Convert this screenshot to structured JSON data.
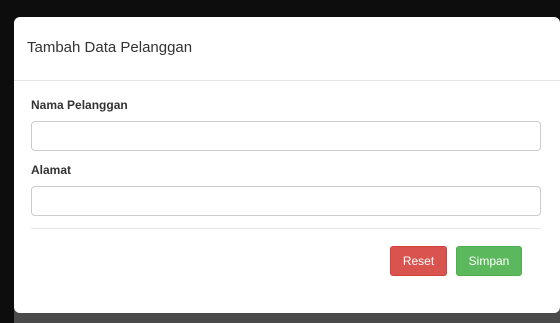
{
  "modal": {
    "title": "Tambah Data Pelanggan"
  },
  "form": {
    "nama": {
      "label": "Nama Pelanggan",
      "value": "",
      "placeholder": ""
    },
    "alamat": {
      "label": "Alamat",
      "value": "",
      "placeholder": ""
    }
  },
  "buttons": {
    "reset_label": "Reset",
    "save_label": "Simpan"
  },
  "colors": {
    "reset": "#d9534f",
    "save": "#5cb85c"
  }
}
